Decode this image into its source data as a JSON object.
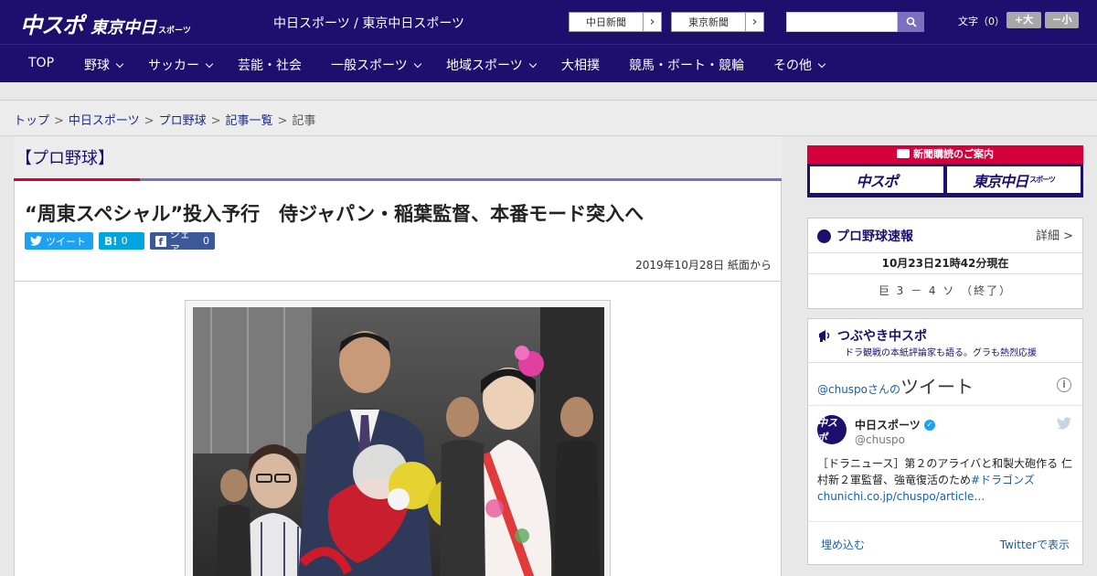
{
  "header": {
    "logo_main": "中スポ",
    "logo_sub": "東京中日",
    "logo_sub_small": "スポーツ",
    "site_name": "中日スポーツ / 東京中日スポーツ",
    "paper_buttons": [
      "中日新聞",
      "東京新聞"
    ],
    "search_placeholder": "",
    "font_size_label": "文字（0）",
    "font_plus": "+大",
    "font_minus": "－小"
  },
  "nav": {
    "items": [
      {
        "label": "TOP",
        "has_dropdown": false
      },
      {
        "label": "野球",
        "has_dropdown": true
      },
      {
        "label": "サッカー",
        "has_dropdown": true
      },
      {
        "label": "芸能・社会",
        "has_dropdown": false
      },
      {
        "label": "一般スポーツ",
        "has_dropdown": true
      },
      {
        "label": "地域スポーツ",
        "has_dropdown": true
      },
      {
        "label": "大相撲",
        "has_dropdown": false
      },
      {
        "label": "競馬・ボート・競輪",
        "has_dropdown": false
      },
      {
        "label": "その他",
        "has_dropdown": true
      }
    ]
  },
  "breadcrumb": {
    "items": [
      "トップ",
      "中日スポーツ",
      "プロ野球",
      "記事一覧",
      "記事"
    ],
    "separator": ">"
  },
  "article": {
    "section": "【プロ野球】",
    "headline": "“周東スペシャル”投入予行　侍ジャパン・稲葉監督、本番モード突入へ",
    "share": {
      "tweet_label": "ツイート",
      "hatena_label": "B!",
      "hatena_count": "0",
      "facebook_label": "シェア",
      "facebook_count": "0"
    },
    "date": "2019年10月28日 紙面から"
  },
  "sidebar": {
    "subscribe": {
      "header": "新聞購読のご案内",
      "logos": [
        "中スポ",
        "東京中日"
      ],
      "logo_small": "スポーツ"
    },
    "score": {
      "title": "プロ野球速報",
      "detail": "詳細 >",
      "time": "10月23日21時42分現在",
      "result": "巨 3 － 4 ソ （終了）"
    },
    "twitter": {
      "title": "つぶやき中スポ",
      "subtitle": "ドラ観戦の本紙評論家も語る。グラも熱烈応援",
      "handle_prefix": "@chuspo",
      "handle_suffix": "さんの",
      "heading": "ツイート",
      "account_name": "中日スポーツ",
      "account_handle": "@chuspo",
      "avatar_text": "中スポ",
      "tweet_text": "［ドラニュース］第２のアライバと和製大砲作る 仁村新２軍監督、強竜復活のため",
      "tweet_link": "#ドラゴンズchunichi.co.jp/chuspo/article…",
      "embed": "埋め込む",
      "view": "Twitterで表示"
    }
  }
}
